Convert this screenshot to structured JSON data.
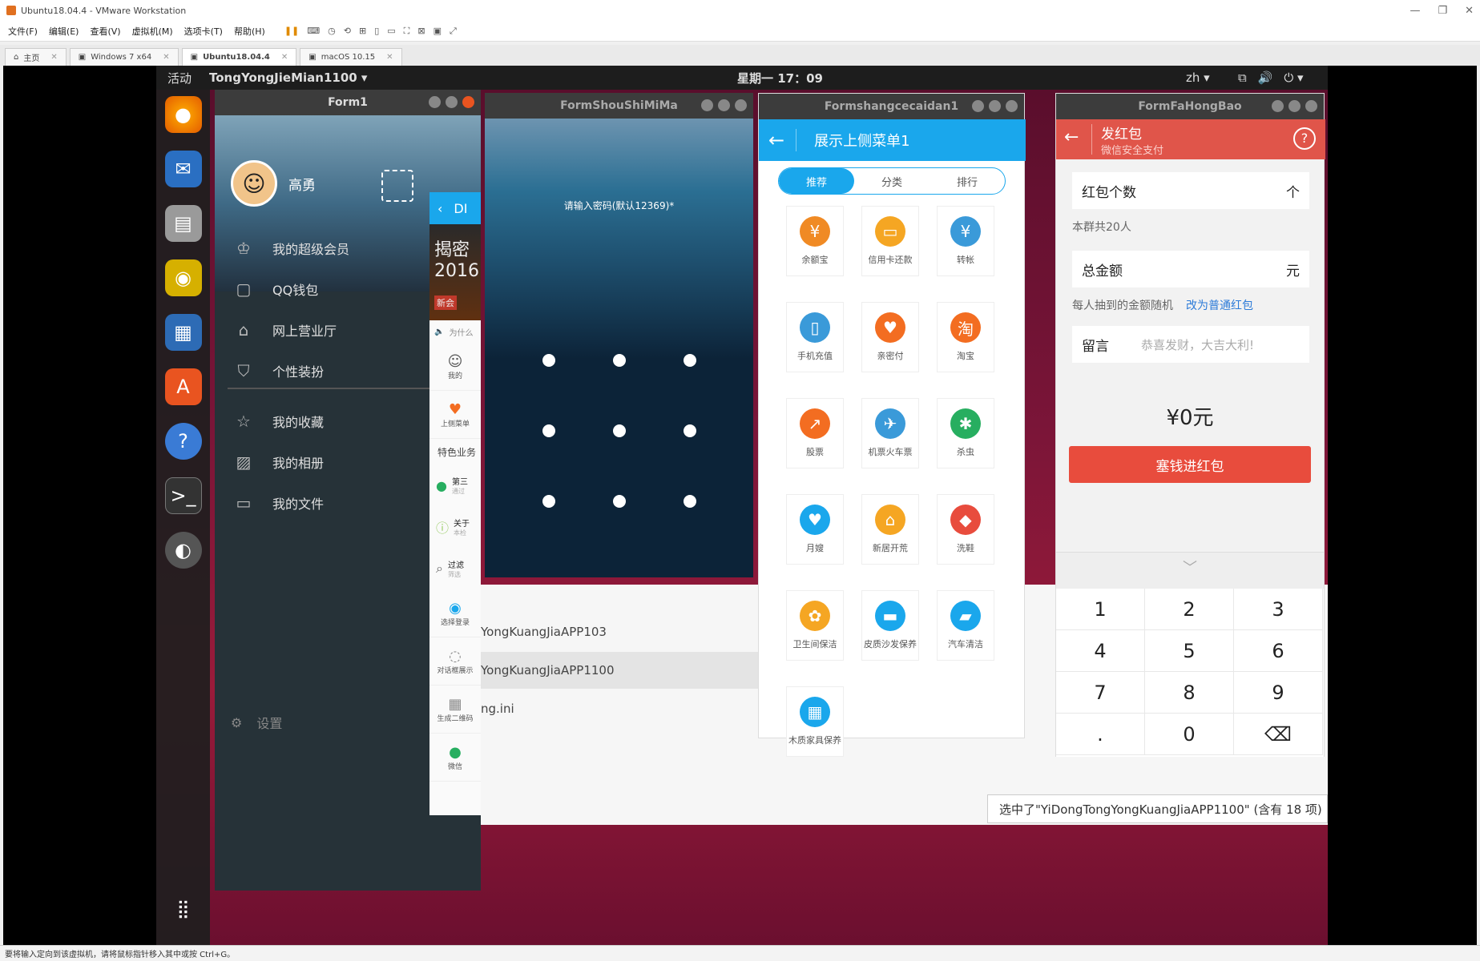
{
  "vmware": {
    "title": "Ubuntu18.04.4 - VMware Workstation",
    "menu": [
      "文件(F)",
      "编辑(E)",
      "查看(V)",
      "虚拟机(M)",
      "选项卡(T)",
      "帮助(H)"
    ],
    "tabs": [
      {
        "label": "主页"
      },
      {
        "label": "Windows 7 x64"
      },
      {
        "label": "Ubuntu18.04.4"
      },
      {
        "label": "macOS 10.15"
      }
    ],
    "status_text": "要将输入定向到该虚拟机，请将鼠标指针移入其中或按 Ctrl+G。"
  },
  "ubuntu": {
    "activities": "活动",
    "app_menu": "TongYongJieMian1100",
    "clock": "星期一 17：09",
    "input_method": "zh"
  },
  "files": {
    "rows": [
      "YongKuangJiaAPP103",
      "YongKuangJiaAPP1100",
      "ng.ini"
    ],
    "status": "选中了\"YiDongTongYongKuangJiaAPP1100\" (含有 18 项)"
  },
  "form1": {
    "title": "Form1",
    "user_name": "高勇",
    "menu": [
      {
        "label": "我的超级会员",
        "icon": "crown-icon"
      },
      {
        "label": "QQ钱包",
        "icon": "wallet-icon"
      },
      {
        "label": "网上营业厅",
        "icon": "store-icon"
      },
      {
        "label": "个性装扮",
        "icon": "shirt-icon"
      },
      {
        "label": "我的收藏",
        "icon": "star-icon"
      },
      {
        "label": "我的相册",
        "icon": "photo-icon"
      },
      {
        "label": "我的文件",
        "icon": "folder-icon"
      }
    ],
    "settings": "设置"
  },
  "qq_strip": {
    "top_label": "DI",
    "banner_text": "揭密 2016",
    "banner_sub": "新会",
    "notice": "为什么",
    "tiles": [
      "我的",
      "上侧菜单",
      "选择登录",
      "对话框展示",
      "生成二维码",
      "微信"
    ],
    "section": "特色业务",
    "items": [
      {
        "title": "第三",
        "sub": "通过"
      },
      {
        "title": "关于",
        "sub": "本检"
      },
      {
        "title": "过滤",
        "sub": "筛选"
      }
    ]
  },
  "form_shoushi": {
    "title": "FormShouShiMiMa",
    "hint": "请输入密码(默认12369)*"
  },
  "form_shangce": {
    "title": "Formshangcecaidan1",
    "header": "展示上侧菜单1",
    "segments": [
      "推荐",
      "分类",
      "排行"
    ],
    "grid": [
      {
        "label": "余额宝",
        "color": "#f08a24",
        "glyph": "¥"
      },
      {
        "label": "信用卡还款",
        "color": "#f5a623",
        "glyph": "▭"
      },
      {
        "label": "转帐",
        "color": "#3a9ad9",
        "glyph": "¥"
      },
      {
        "label": "手机充值",
        "color": "#3a9ad9",
        "glyph": "▯"
      },
      {
        "label": "亲密付",
        "color": "#f36d21",
        "glyph": "♥"
      },
      {
        "label": "淘宝",
        "color": "#f36d21",
        "glyph": "淘"
      },
      {
        "label": "股票",
        "color": "#f36d21",
        "glyph": "↗"
      },
      {
        "label": "机票火车票",
        "color": "#3a9ad9",
        "glyph": "✈"
      },
      {
        "label": "杀虫",
        "color": "#27ae60",
        "glyph": "✱"
      },
      {
        "label": "月嫂",
        "color": "#1aa7ec",
        "glyph": "♥"
      },
      {
        "label": "新居开荒",
        "color": "#f5a623",
        "glyph": "⌂"
      },
      {
        "label": "洗鞋",
        "color": "#e84c3d",
        "glyph": "◆"
      },
      {
        "label": "卫生间保洁",
        "color": "#f5a623",
        "glyph": "✿"
      },
      {
        "label": "皮质沙发保养",
        "color": "#1aa7ec",
        "glyph": "▬"
      },
      {
        "label": "汽车清洁",
        "color": "#1aa7ec",
        "glyph": "▰"
      },
      {
        "label": "木质家具保养",
        "color": "#1aa7ec",
        "glyph": "▦"
      }
    ]
  },
  "form_hongbao": {
    "title": "FormFaHongBao",
    "header": "发红包",
    "header_sub": "微信安全支付",
    "count_label": "红包个数",
    "count_value": "个",
    "group_info": "本群共20人",
    "amount_label": "总金额",
    "amount_unit": "元",
    "random_text": "每人抽到的金额随机",
    "change_link": "改为普通红包",
    "message_label": "留言",
    "message_placeholder": "恭喜发财，大吉大利!",
    "total": "¥0元",
    "submit": "塞钱进红包",
    "keys": [
      "1",
      "2",
      "3",
      "4",
      "5",
      "6",
      "7",
      "8",
      "9",
      ".",
      "0",
      "⌫"
    ]
  }
}
